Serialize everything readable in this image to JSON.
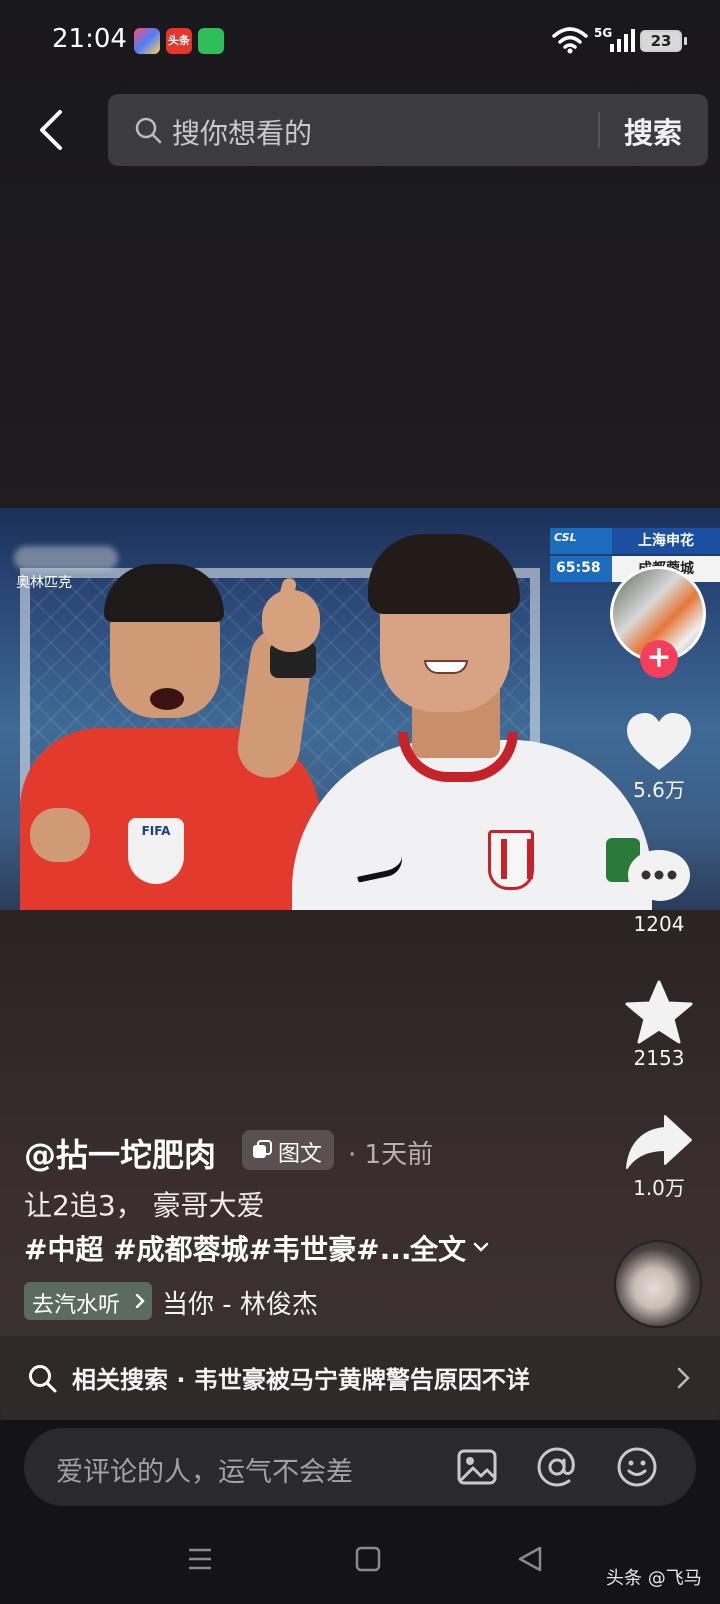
{
  "status_bar": {
    "time": "21:04",
    "network": "5G",
    "battery": "23",
    "apps": [
      {
        "icon": "app-icon-colorful"
      },
      {
        "label": "头条"
      },
      {
        "icon": "shield-icon"
      }
    ]
  },
  "header": {
    "search_placeholder": "搜你想看的",
    "search_button": "搜索"
  },
  "video": {
    "watermark_text": "奥林匹克",
    "scoreboard": {
      "league": "CSL",
      "time": "65:58",
      "team1": "上海申花",
      "team2": "成都蓉城"
    },
    "badge_text": "FIFA"
  },
  "actions": {
    "likes": "5.6万",
    "comments": "1204",
    "favorites": "2153",
    "shares": "1.0万"
  },
  "post": {
    "author": "@拈一坨肥肉",
    "type_label": "图文",
    "time": "· 1天前",
    "caption": "让2追3， 豪哥大爱",
    "hashtags": "#中超 #成都蓉城#韦世豪#...",
    "more": "全文",
    "music_chip": "去汽水听",
    "music_title": "当你 - 林俊杰"
  },
  "related": {
    "text": "相关搜索 · 韦世豪被马宁黄牌警告原因不详"
  },
  "comment_bar": {
    "placeholder": "爱评论的人，运气不会差"
  },
  "watermark": "头条 @飞马",
  "colors": {
    "accent_follow": "#f53d5c",
    "scoreboard_blue": "#1d6bbd",
    "music_chip": "#5b6b5e"
  }
}
